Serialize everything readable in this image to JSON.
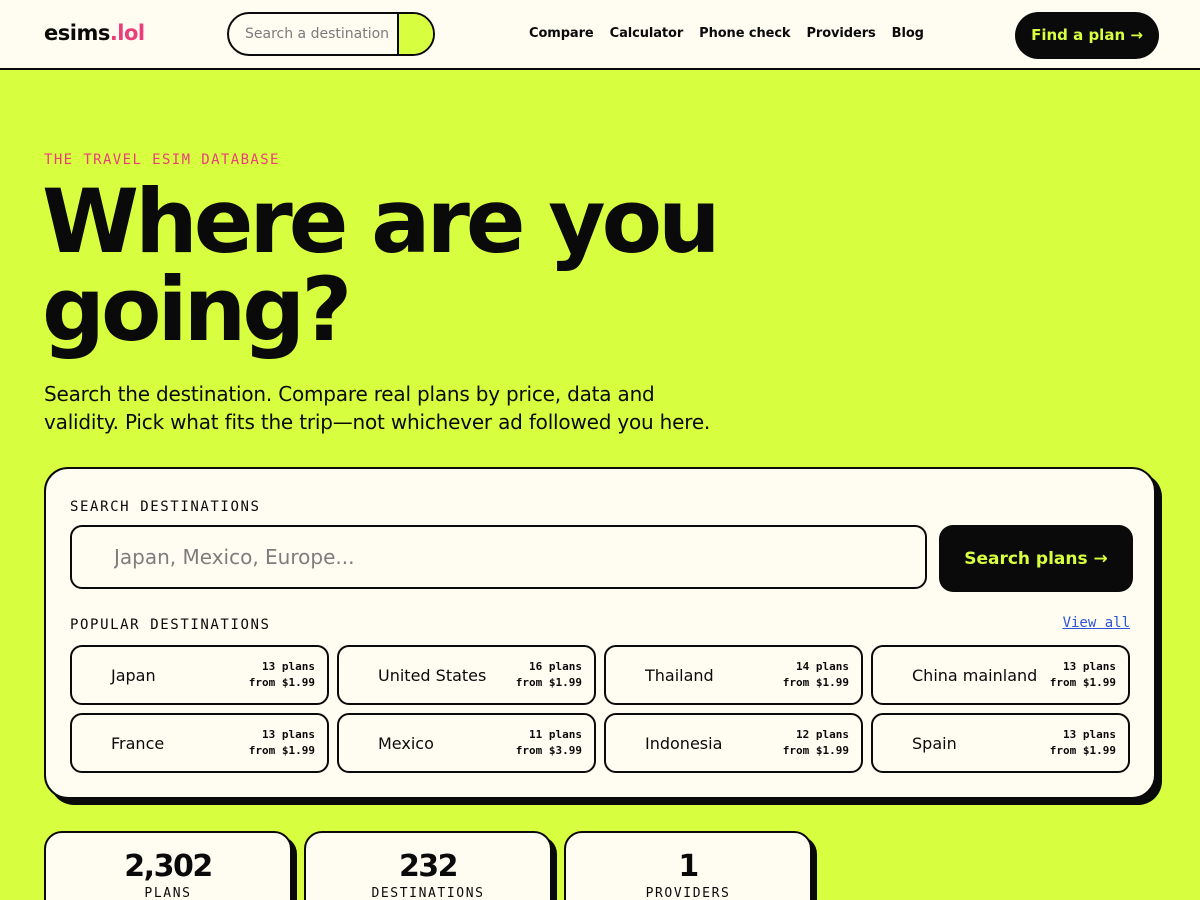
{
  "header": {
    "logo_main": "esims",
    "logo_accent": ".lol",
    "search_placeholder": "Search a destination",
    "nav": [
      "Compare",
      "Calculator",
      "Phone check",
      "Providers",
      "Blog"
    ],
    "cta_label": "Find a plan →"
  },
  "hero": {
    "eyebrow": "THE TRAVEL ESIM DATABASE",
    "title": "Where are you going?",
    "subtitle": "Search the destination. Compare real plans by price, data and validity. Pick what fits the trip—not whichever ad followed you here."
  },
  "search": {
    "label": "SEARCH DESTINATIONS",
    "placeholder": "Japan, Mexico, Europe...",
    "button_label": "Search plans →",
    "popular_label": "POPULAR DESTINATIONS",
    "view_all_label": "View all",
    "destinations": [
      {
        "name": "Japan",
        "plans": "13 plans",
        "from": "from $1.99"
      },
      {
        "name": "United States",
        "plans": "16 plans",
        "from": "from $1.99"
      },
      {
        "name": "Thailand",
        "plans": "14 plans",
        "from": "from $1.99"
      },
      {
        "name": "China mainland",
        "plans": "13 plans",
        "from": "from $1.99"
      },
      {
        "name": "France",
        "plans": "13 plans",
        "from": "from $1.99"
      },
      {
        "name": "Mexico",
        "plans": "11 plans",
        "from": "from $3.99"
      },
      {
        "name": "Indonesia",
        "plans": "12 plans",
        "from": "from $1.99"
      },
      {
        "name": "Spain",
        "plans": "13 plans",
        "from": "from $1.99"
      }
    ]
  },
  "stats": [
    {
      "value": "2,302",
      "label": "PLANS"
    },
    {
      "value": "232",
      "label": "DESTINATIONS"
    },
    {
      "value": "1",
      "label": "PROVIDERS"
    }
  ],
  "colors": {
    "background": "#d8ff3f",
    "accent_pink": "#ea3e7a",
    "link_blue": "#2f55d4",
    "ink": "#0a0a0a",
    "card": "#fffcf2"
  }
}
